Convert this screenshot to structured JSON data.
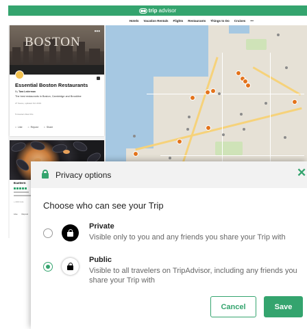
{
  "colors": {
    "accent": "#34a46e",
    "map_pin": "#e3731c",
    "water": "#a6c8e2"
  },
  "brand": {
    "logo_icon": "owl-eyes-icon",
    "part1": "trip",
    "part2": "advisor"
  },
  "nav": {
    "items": [
      "Hotels",
      "Vacation Rentals",
      "Flights",
      "Restaurants",
      "Things to Do",
      "Cruises",
      "•••"
    ]
  },
  "trip_card": {
    "hero_text": "BOSTON",
    "menu": "•••",
    "title": "Essential Boston Restaurants",
    "by_prefix": "By",
    "author": "Tara Lederman",
    "description": "The best restaurants in Boston, Cambridge and Brookline",
    "meta": "27 Saves, updated Oct 2019",
    "link": "5 travelers liked this",
    "actions": [
      "Like",
      "Repost",
      "Share"
    ]
  },
  "card2": {
    "title": "Eastern",
    "link": "+ Add note",
    "actions": [
      "Like",
      "Repost"
    ]
  },
  "dialog": {
    "lock_icon": "lock-icon",
    "title": "Privacy options",
    "close": "✕",
    "question": "Choose who can see your Trip",
    "options": [
      {
        "name": "Private",
        "description": "Visible only to you and any friends you share your Trip with",
        "selected": false,
        "icon": "lock-icon"
      },
      {
        "name": "Public",
        "description": "Visible to all travelers on TripAdvisor, including any friends you share your Trip with",
        "selected": true,
        "icon": "lock-icon"
      }
    ],
    "cancel_label": "Cancel",
    "save_label": "Save"
  }
}
